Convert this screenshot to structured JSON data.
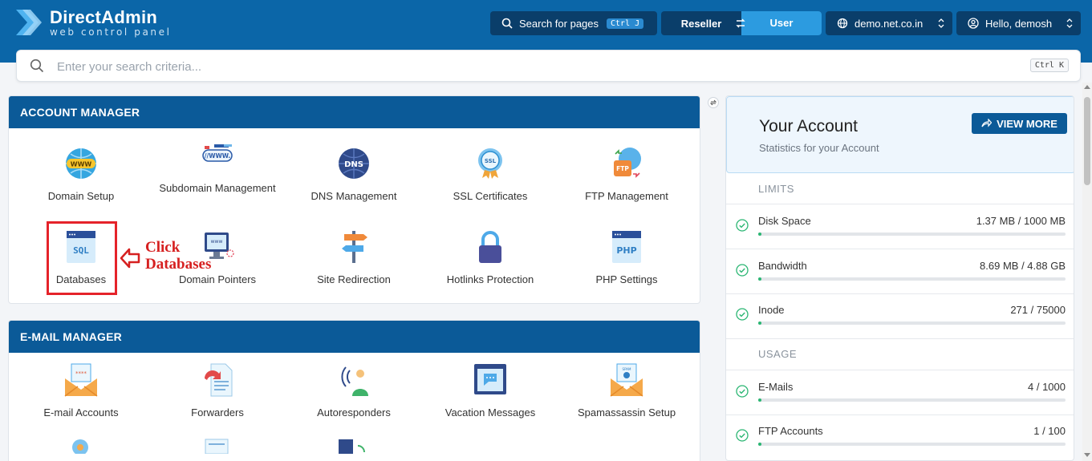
{
  "header": {
    "logo_title": "DirectAdmin",
    "logo_subtitle": "web control panel",
    "search_pages_label": "Search for pages",
    "search_pages_shortcut": "Ctrl J",
    "role_reseller": "Reseller",
    "role_user": "User",
    "domain": "demo.net.co.in",
    "greeting": "Hello, demosh"
  },
  "search": {
    "placeholder": "Enter your search criteria...",
    "shortcut": "Ctrl K"
  },
  "account_manager": {
    "title": "ACCOUNT MANAGER",
    "items": [
      {
        "label": "Domain Setup",
        "icon": "www-globe-icon"
      },
      {
        "label": "Subdomain Management",
        "icon": "subdomain-icon"
      },
      {
        "label": "DNS Management",
        "icon": "dns-icon"
      },
      {
        "label": "SSL Certificates",
        "icon": "ssl-badge-icon"
      },
      {
        "label": "FTP Management",
        "icon": "ftp-icon"
      },
      {
        "label": "Databases",
        "icon": "sql-database-icon"
      },
      {
        "label": "Domain Pointers",
        "icon": "domain-pointer-icon"
      },
      {
        "label": "Site Redirection",
        "icon": "signpost-icon"
      },
      {
        "label": "Hotlinks Protection",
        "icon": "padlock-icon"
      },
      {
        "label": "PHP Settings",
        "icon": "php-icon"
      }
    ]
  },
  "email_manager": {
    "title": "E-MAIL MANAGER",
    "items": [
      {
        "label": "E-mail Accounts",
        "icon": "email-envelope-icon"
      },
      {
        "label": "Forwarders",
        "icon": "forward-icon"
      },
      {
        "label": "Autoresponders",
        "icon": "autoresponder-icon"
      },
      {
        "label": "Vacation Messages",
        "icon": "vacation-message-icon"
      },
      {
        "label": "Spamassassin Setup",
        "icon": "spam-envelope-icon"
      }
    ]
  },
  "annotation": {
    "line1": "Click",
    "line2": "Databases"
  },
  "account": {
    "title": "Your Account",
    "subtitle": "Statistics for your Account",
    "view_more": "VIEW MORE",
    "limits_label": "LIMITS",
    "usage_label": "USAGE",
    "limits": [
      {
        "name": "Disk Space",
        "value": "1.37 MB / 1000 MB",
        "fraction": 0.0014
      },
      {
        "name": "Bandwidth",
        "value": "8.69 MB / 4.88 GB",
        "fraction": 0.0017
      },
      {
        "name": "Inode",
        "value": "271 / 75000",
        "fraction": 0.0036
      }
    ],
    "usage": [
      {
        "name": "E-Mails",
        "value": "4 / 1000",
        "fraction": 0.004
      },
      {
        "name": "FTP Accounts",
        "value": "1 / 100",
        "fraction": 0.01
      }
    ]
  },
  "colors": {
    "header": "#0b66a8",
    "panel_head": "#0b5a98",
    "accent": "#2c9be0",
    "highlight": "#e5232a",
    "progress": "#2bb673"
  }
}
